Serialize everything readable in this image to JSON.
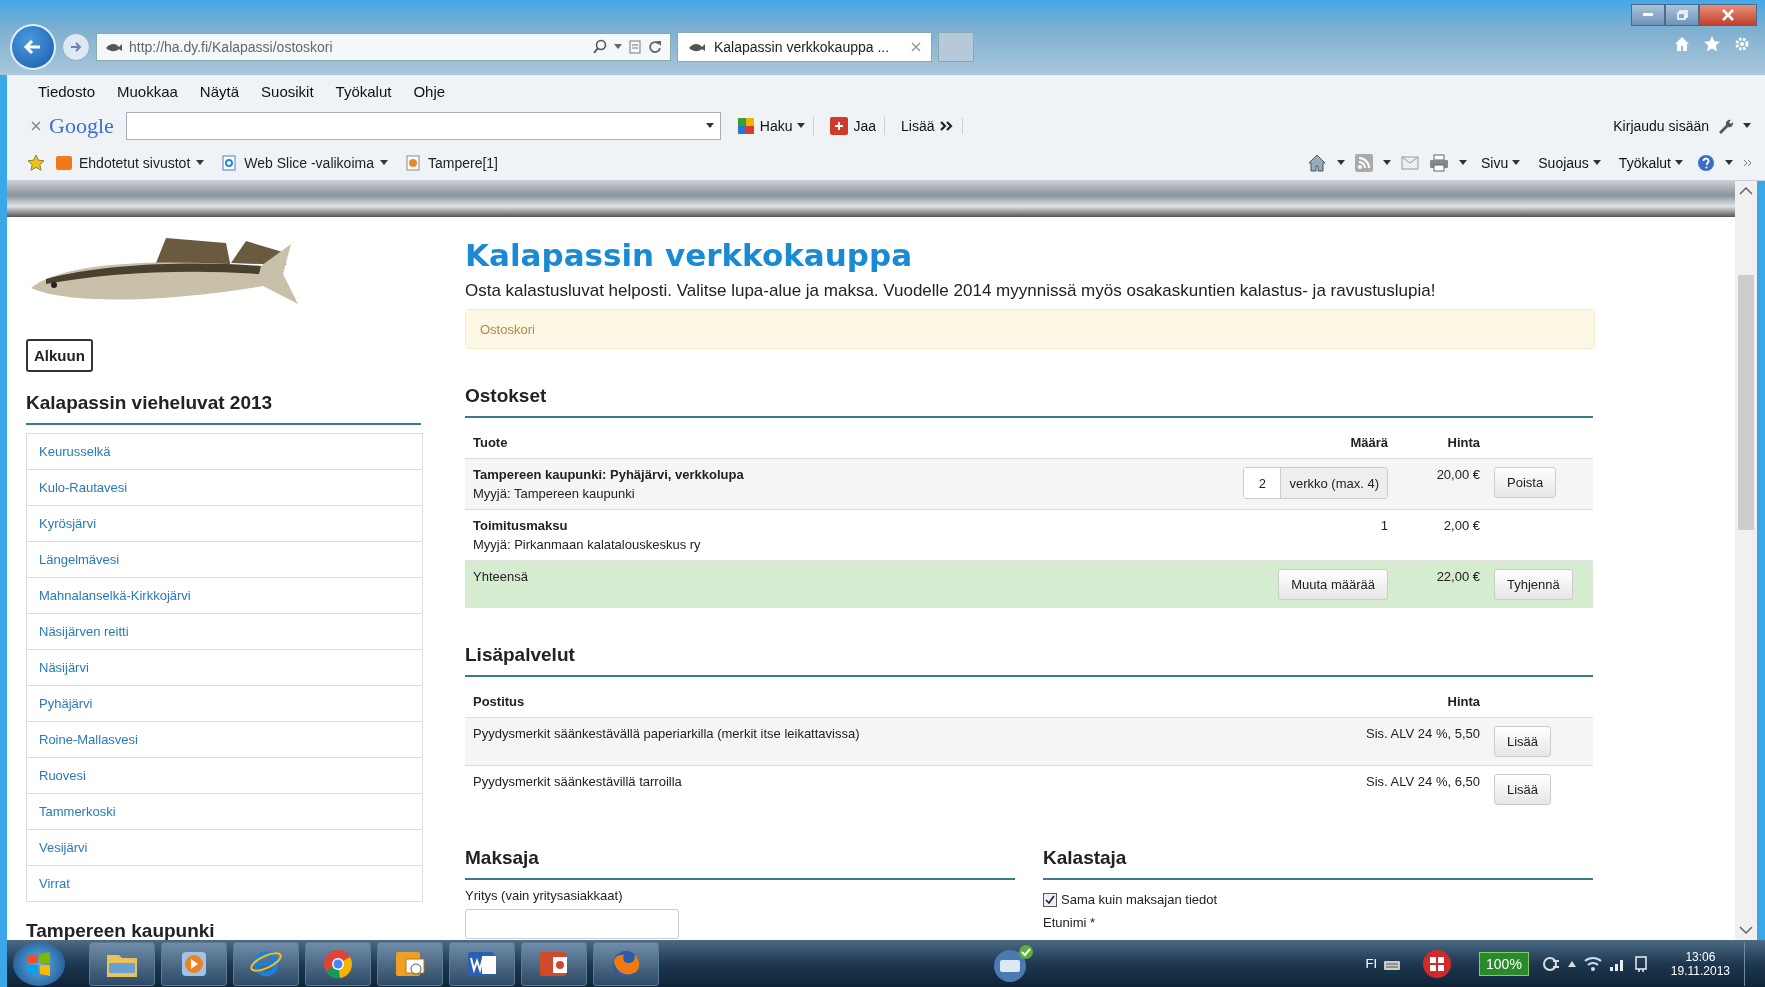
{
  "browser": {
    "address": "http://ha.dy.fi/Kalapassi/ostoskori",
    "tabs": [
      {
        "title": "Kalapassin verkkokauppa ...",
        "selected": true
      }
    ],
    "menu": [
      "Tiedosto",
      "Muokkaa",
      "Näytä",
      "Suosikit",
      "Työkalut",
      "Ohje"
    ],
    "google_toolbar": {
      "logo": "Google",
      "buttons": [
        {
          "label": "Haku",
          "kind": "search"
        },
        {
          "label": "Jaa",
          "kind": "share"
        },
        {
          "label": "Lisää",
          "kind": "more"
        }
      ],
      "sign_in": "Kirjaudu sisään"
    },
    "favorites": [
      {
        "label": "Ehdotetut sivustot",
        "dropdown": true
      },
      {
        "label": "Web Slice -valikoima",
        "dropdown": true
      },
      {
        "label": "Tampere[1]",
        "dropdown": false
      }
    ],
    "command_bar": [
      "Sivu",
      "Suojaus",
      "Työkalut"
    ]
  },
  "sidebar": {
    "home_button": "Alkuun",
    "heading": "Kalapassin vieheluvat 2013",
    "items": [
      "Keurusselkä",
      "Kulo-Rautavesi",
      "Kyrösjärvi",
      "Längelmävesi",
      "Mahnalanselkä-Kirkkojärvi",
      "Näsijärven reitti",
      "Näsijärvi",
      "Pyhäjärvi",
      "Roine-Mallasvesi",
      "Ruovesi",
      "Tammerkoski",
      "Vesijärvi",
      "Virrat"
    ],
    "next_heading": "Tampereen kaupunki"
  },
  "main": {
    "title": "Kalapassin verkkokauppa",
    "intro": "Osta kalastusluvat helposti. Valitse lupa-alue ja maksa. Vuodelle 2014 myynnissä myös osakaskuntien kalastus- ja ravustuslupia!",
    "breadcrumb": "Ostoskori",
    "purchases": {
      "heading": "Ostokset",
      "columns": [
        "Tuote",
        "Määrä",
        "Hinta"
      ],
      "rows": [
        {
          "kind": "editable",
          "product": "Tampereen kaupunki: Pyhäjärvi, verkkolupa",
          "seller": "Myyjä: Tampereen kaupunki",
          "quantity": "2",
          "unit": "verkko (max. 4)",
          "price": "20,00 €",
          "action": "Poista"
        },
        {
          "kind": "fixed",
          "product": "Toimitusmaksu",
          "seller": "Myyjä: Pirkanmaan kalatalouskeskus ry",
          "quantity": "1",
          "price": "2,00 €"
        }
      ],
      "total": {
        "label": "Yhteensä",
        "update_button": "Muuta määrää",
        "price": "22,00 €",
        "clear_button": "Tyhjennä"
      }
    },
    "extras": {
      "heading": "Lisäpalvelut",
      "columns": [
        "Postitus",
        "Hinta"
      ],
      "rows": [
        {
          "description": "Pyydysmerkit säänkestävällä paperiarkilla (merkit itse leikattavissa)",
          "price": "Sis. ALV 24 %, 5,50",
          "button": "Lisää"
        },
        {
          "description": "Pyydysmerkit säänkestävillä tarroilla",
          "price": "Sis. ALV 24 %, 6,50",
          "button": "Lisää"
        }
      ]
    },
    "payer": {
      "heading": "Maksaja",
      "field_label": "Yritys (vain yritysasiakkaat)"
    },
    "fisher": {
      "heading": "Kalastaja",
      "same_as_payer": {
        "label": "Sama kuin maksajan tiedot",
        "checked": true
      },
      "field_label": "Etunimi *"
    }
  },
  "taskbar": {
    "language": "FI",
    "battery": "100%",
    "time": "13:06",
    "date": "19.11.2013"
  }
}
